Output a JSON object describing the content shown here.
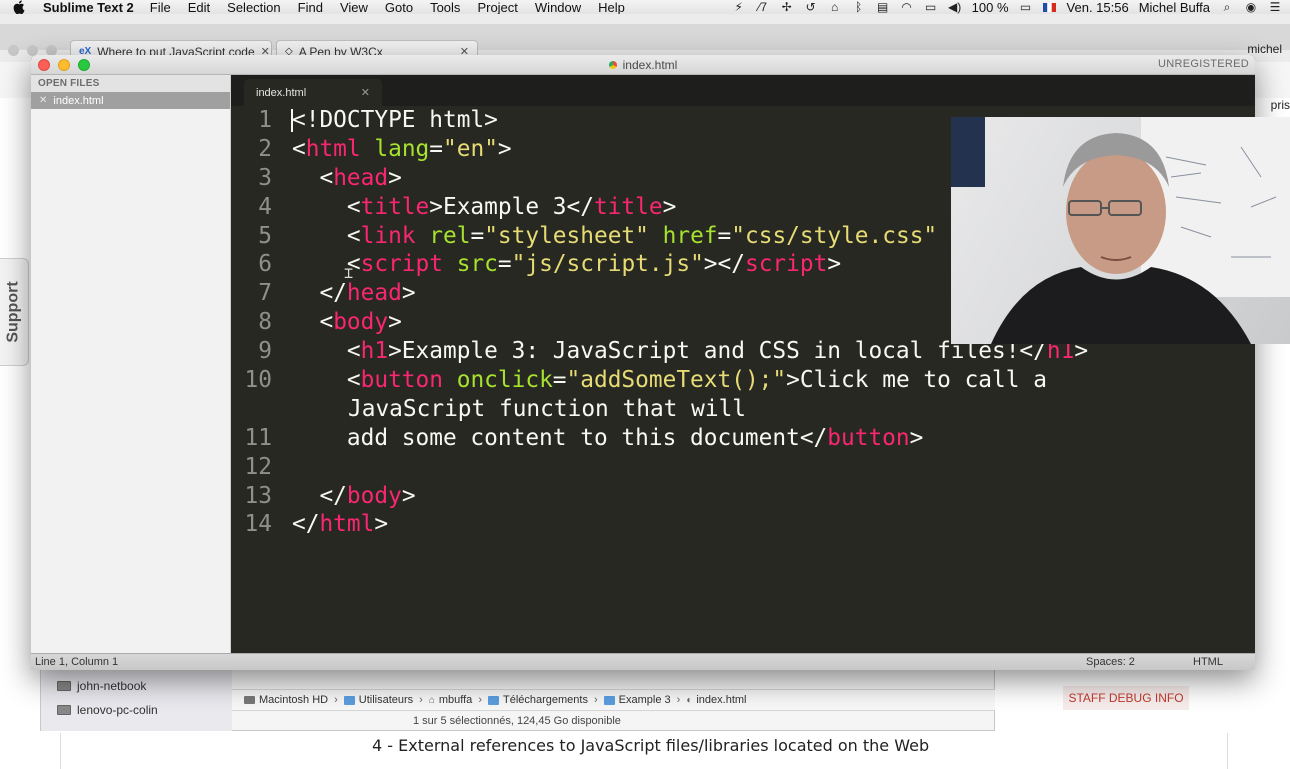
{
  "menubar": {
    "app_name": "Sublime Text 2",
    "items": [
      "File",
      "Edit",
      "Selection",
      "Find",
      "View",
      "Goto",
      "Tools",
      "Project",
      "Window",
      "Help"
    ],
    "status_number": "7",
    "battery": "100 %",
    "clock": "Ven. 15:56",
    "user": "Michel Buffa"
  },
  "browser": {
    "tabs": [
      {
        "favicon": "eX",
        "title": "Where to put JavaScript code"
      },
      {
        "favicon": "icon",
        "title": "A Pen by W3Cx"
      }
    ],
    "profile": "michel",
    "right_partial": "pris",
    "support_tab": "Support",
    "staff_debug": "STAFF DEBUG INFO",
    "section_heading": "4 - External references to JavaScript files/libraries located on the Web"
  },
  "finder": {
    "devices": [
      "john-netbook",
      "lenovo-pc-colin"
    ],
    "path": [
      "Macintosh HD",
      "Utilisateurs",
      "mbuffa",
      "Téléchargements",
      "Example 3",
      "index.html"
    ],
    "status": "1 sur 5 sélectionnés, 124,45 Go disponible"
  },
  "sublime": {
    "window_title": "index.html",
    "unregistered": "UNREGISTERED",
    "sidebar_header": "OPEN FILES",
    "open_files": [
      "index.html"
    ],
    "tab": "index.html",
    "status_position": "Line 1, Column 1",
    "status_spaces": "Spaces: 2",
    "status_syntax": "HTML",
    "code": [
      {
        "ln": "1",
        "tokens": [
          [
            "p",
            "<!DOCTYPE html>"
          ]
        ]
      },
      {
        "ln": "2",
        "tokens": [
          [
            "p",
            "<"
          ],
          [
            "t",
            "html"
          ],
          [
            "p",
            " "
          ],
          [
            "a",
            "lang"
          ],
          [
            "p",
            "="
          ],
          [
            "s",
            "\"en\""
          ],
          [
            "p",
            ">"
          ]
        ]
      },
      {
        "ln": "3",
        "tokens": [
          [
            "p",
            "  <"
          ],
          [
            "t",
            "head"
          ],
          [
            "p",
            ">"
          ]
        ]
      },
      {
        "ln": "4",
        "tokens": [
          [
            "p",
            "    <"
          ],
          [
            "t",
            "title"
          ],
          [
            "p",
            ">Example 3</"
          ],
          [
            "t",
            "title"
          ],
          [
            "p",
            ">"
          ]
        ]
      },
      {
        "ln": "5",
        "tokens": [
          [
            "p",
            "    <"
          ],
          [
            "t",
            "link"
          ],
          [
            "p",
            " "
          ],
          [
            "a",
            "rel"
          ],
          [
            "p",
            "="
          ],
          [
            "s",
            "\"stylesheet\""
          ],
          [
            "p",
            " "
          ],
          [
            "a",
            "href"
          ],
          [
            "p",
            "="
          ],
          [
            "s",
            "\"css/style.css\""
          ]
        ]
      },
      {
        "ln": "6",
        "tokens": [
          [
            "p",
            "    <"
          ],
          [
            "t",
            "script"
          ],
          [
            "p",
            " "
          ],
          [
            "a",
            "src"
          ],
          [
            "p",
            "="
          ],
          [
            "s",
            "\"js/script.js\""
          ],
          [
            "p",
            "></"
          ],
          [
            "t",
            "script"
          ],
          [
            "p",
            ">"
          ]
        ]
      },
      {
        "ln": "7",
        "tokens": [
          [
            "p",
            "  </"
          ],
          [
            "t",
            "head"
          ],
          [
            "p",
            ">"
          ]
        ]
      },
      {
        "ln": "8",
        "tokens": [
          [
            "p",
            "  <"
          ],
          [
            "t",
            "body"
          ],
          [
            "p",
            ">"
          ]
        ]
      },
      {
        "ln": "9",
        "tokens": [
          [
            "p",
            "    <"
          ],
          [
            "t",
            "h1"
          ],
          [
            "p",
            ">Example 3: JavaScript and CSS in local files!</"
          ],
          [
            "t",
            "h1"
          ],
          [
            "p",
            ">"
          ]
        ]
      },
      {
        "ln": "10",
        "tokens": [
          [
            "p",
            "    <"
          ],
          [
            "t",
            "button"
          ],
          [
            "p",
            " "
          ],
          [
            "a",
            "onclick"
          ],
          [
            "p",
            "="
          ],
          [
            "s",
            "\"addSomeText();\""
          ],
          [
            "p",
            ">Click me to call a"
          ]
        ]
      },
      {
        "ln": "",
        "wrap": true,
        "tokens": [
          [
            "p",
            "JavaScript function that will"
          ]
        ]
      },
      {
        "ln": "11",
        "tokens": [
          [
            "p",
            "    add some content to this document</"
          ],
          [
            "t",
            "button"
          ],
          [
            "p",
            ">"
          ]
        ]
      },
      {
        "ln": "12",
        "tokens": []
      },
      {
        "ln": "13",
        "tokens": [
          [
            "p",
            "  </"
          ],
          [
            "t",
            "body"
          ],
          [
            "p",
            ">"
          ]
        ]
      },
      {
        "ln": "14",
        "tokens": [
          [
            "p",
            "</"
          ],
          [
            "t",
            "html"
          ],
          [
            "p",
            ">"
          ]
        ]
      }
    ]
  },
  "colors": {
    "editor_bg": "#272822",
    "tag": "#f92672",
    "attr": "#a6e22e",
    "string": "#e6db74",
    "plain": "#f8f8f2",
    "gutter": "#8f908a"
  },
  "webcam": {
    "label": "presenter-webcam"
  }
}
